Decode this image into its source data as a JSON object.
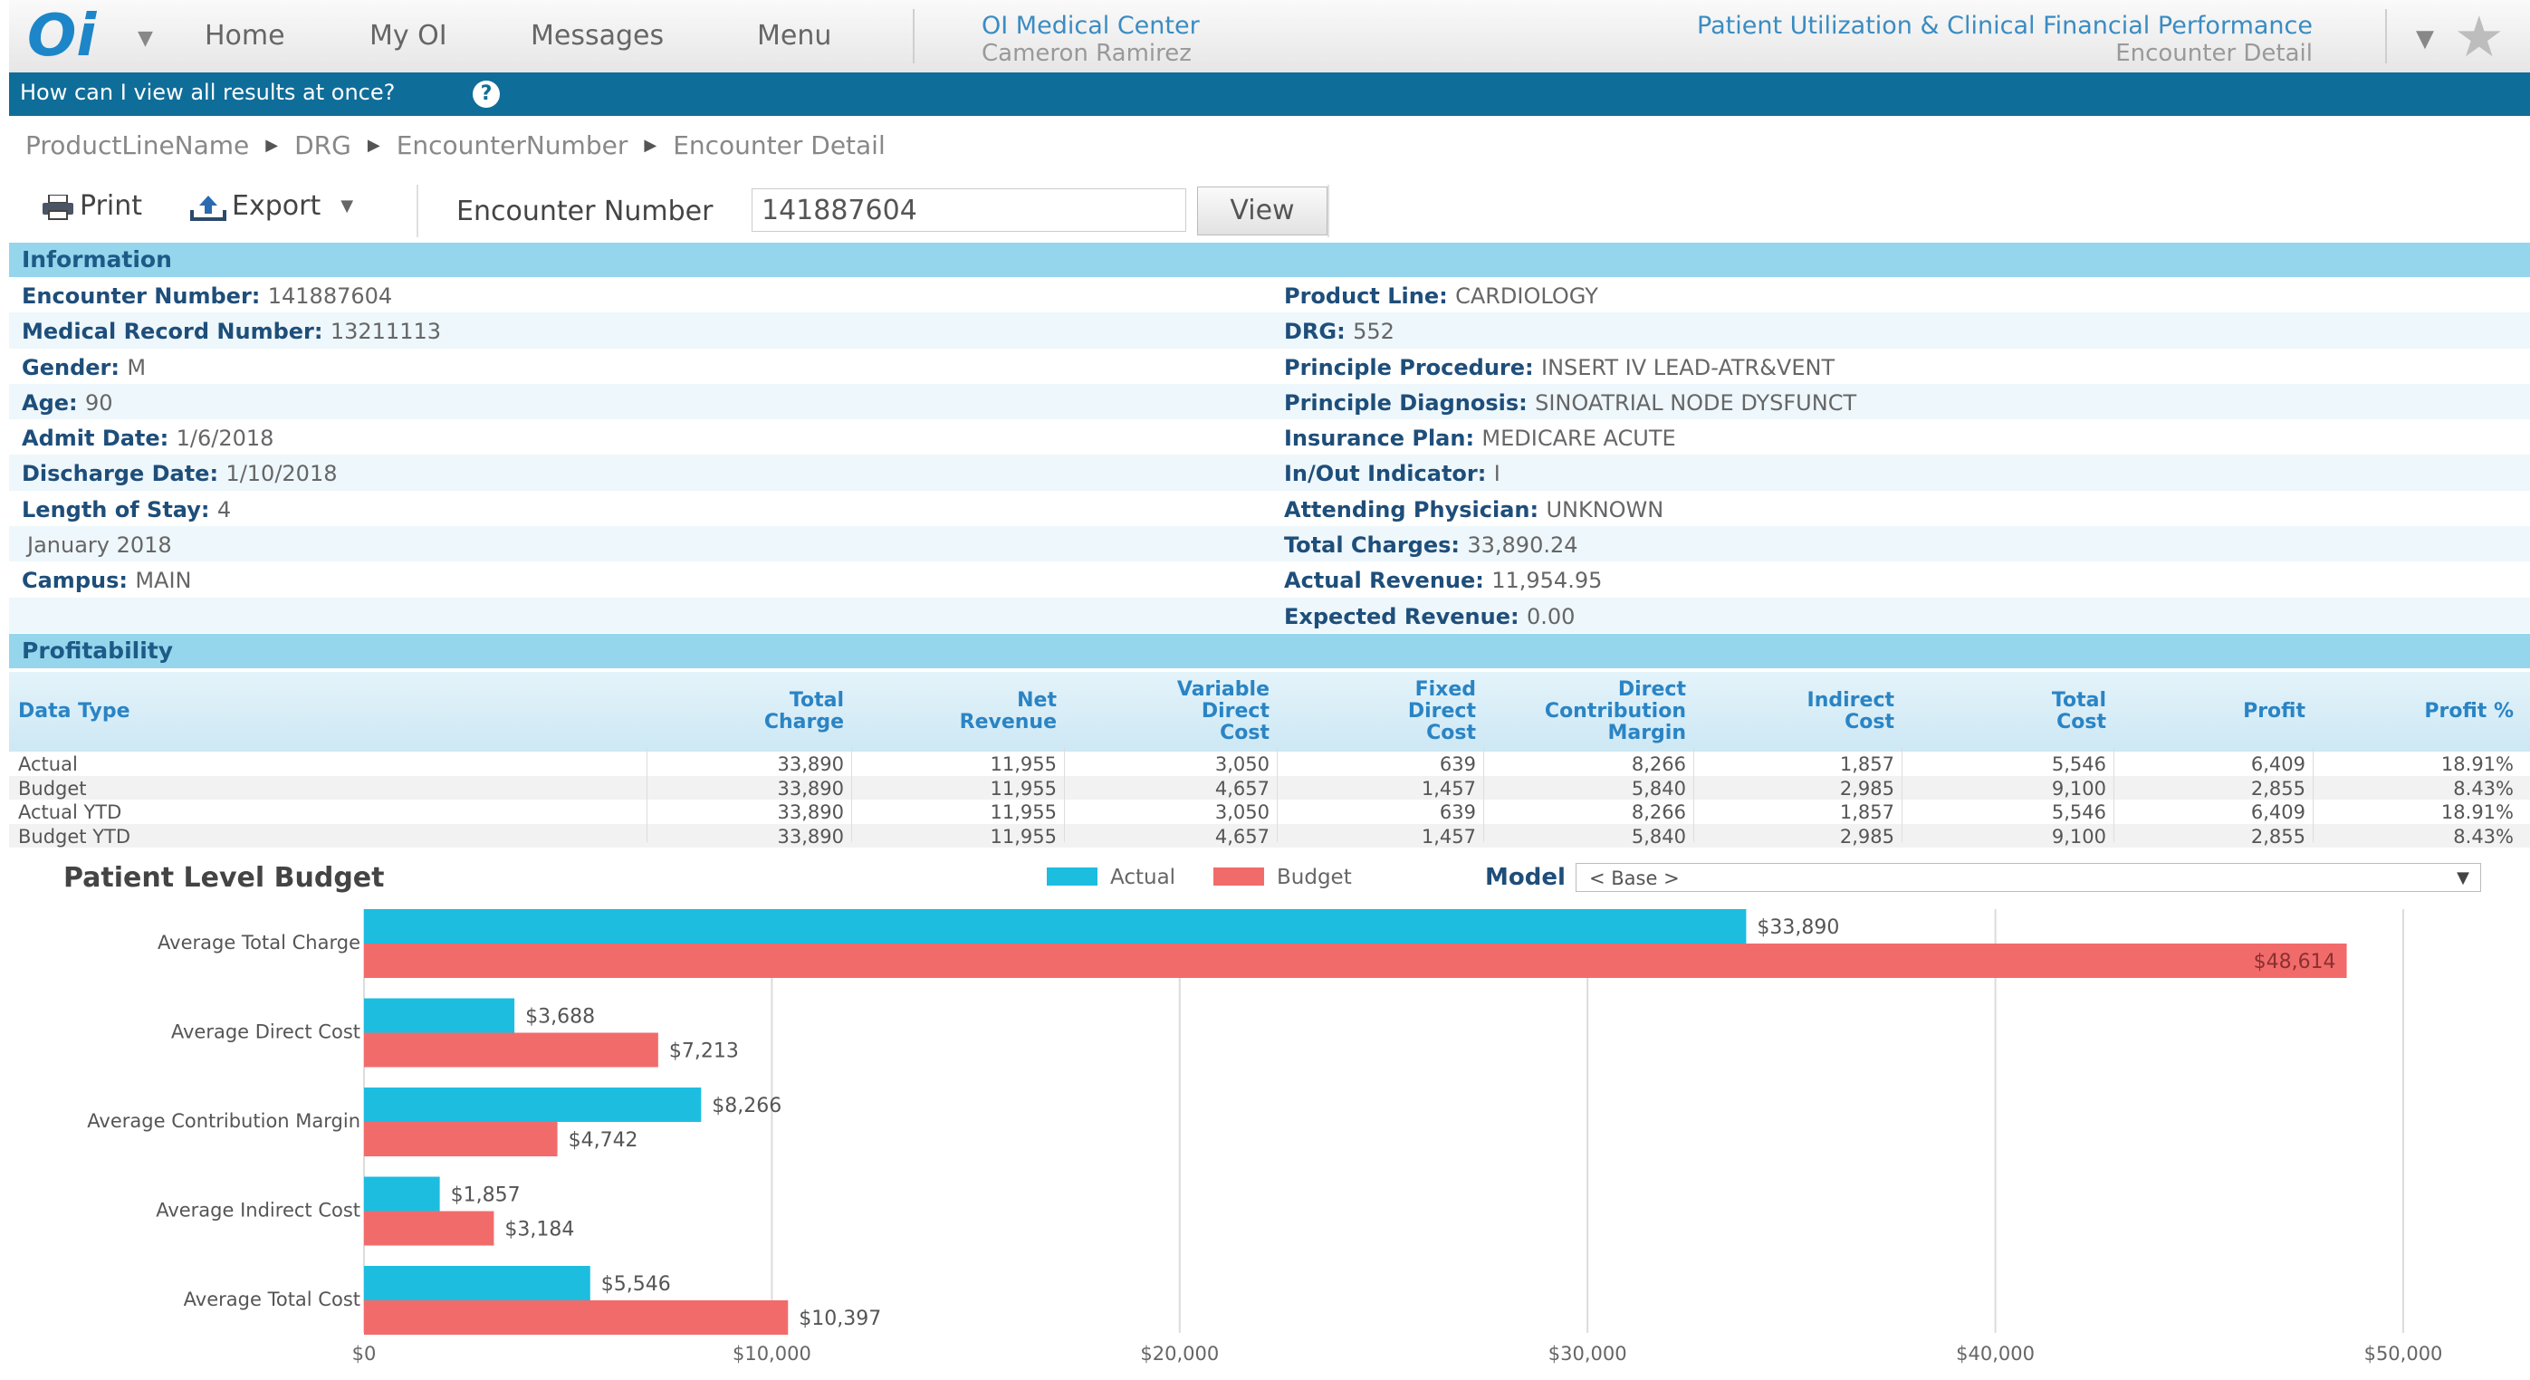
{
  "topbar": {
    "logo": "Oi",
    "nav": [
      "Home",
      "My OI",
      "Messages",
      "Menu"
    ],
    "org_name": "OI Medical Center",
    "user_name": "Cameron Ramirez",
    "report_title": "Patient Utilization & Clinical Financial Performance",
    "report_subtitle": "Encounter Detail"
  },
  "helpbar": {
    "question": "How can I view all results at once?",
    "icon": "?"
  },
  "breadcrumb": [
    "ProductLineName",
    "DRG",
    "EncounterNumber",
    "Encounter Detail"
  ],
  "toolbar": {
    "print_label": "Print",
    "export_label": "Export",
    "encounter_label": "Encounter Number",
    "encounter_value": "141887604",
    "view_label": "View"
  },
  "information": {
    "title": "Information",
    "left": [
      {
        "label": "Encounter Number:",
        "value": "141887604"
      },
      {
        "label": "Medical Record Number:",
        "value": "13211113"
      },
      {
        "label": "Gender:",
        "value": "M"
      },
      {
        "label": "Age:",
        "value": "90"
      },
      {
        "label": "Admit Date:",
        "value": "1/6/2018"
      },
      {
        "label": "Discharge Date:",
        "value": "1/10/2018"
      },
      {
        "label": "Length of Stay:",
        "value": "4"
      },
      {
        "label": "",
        "value": "January 2018"
      },
      {
        "label": "Campus:",
        "value": "MAIN"
      },
      {
        "label": "",
        "value": ""
      }
    ],
    "right": [
      {
        "label": "Product Line:",
        "value": "CARDIOLOGY"
      },
      {
        "label": "DRG:",
        "value": "552"
      },
      {
        "label": "Principle Procedure:",
        "value": "INSERT IV LEAD-ATR&VENT"
      },
      {
        "label": "Principle Diagnosis:",
        "value": "SINOATRIAL NODE DYSFUNCT"
      },
      {
        "label": "Insurance Plan:",
        "value": "MEDICARE ACUTE"
      },
      {
        "label": "In/Out Indicator:",
        "value": "I"
      },
      {
        "label": "Attending Physician:",
        "value": "UNKNOWN"
      },
      {
        "label": "Total Charges:",
        "value": "33,890.24"
      },
      {
        "label": "Actual Revenue:",
        "value": "11,954.95"
      },
      {
        "label": "Expected Revenue:",
        "value": "0.00"
      }
    ]
  },
  "profitability": {
    "title": "Profitability",
    "columns": [
      "Data Type",
      "Total\nCharge",
      "Net\nRevenue",
      "Variable\nDirect\nCost",
      "Fixed\nDirect\nCost",
      "Direct\nContribution\nMargin",
      "Indirect\nCost",
      "Total\nCost",
      "Profit",
      "Profit %"
    ],
    "rows": [
      [
        "Actual",
        "33,890",
        "11,955",
        "3,050",
        "639",
        "8,266",
        "1,857",
        "5,546",
        "6,409",
        "18.91%"
      ],
      [
        "Budget",
        "33,890",
        "11,955",
        "4,657",
        "1,457",
        "5,840",
        "2,985",
        "9,100",
        "2,855",
        "8.43%"
      ],
      [
        "Actual YTD",
        "33,890",
        "11,955",
        "3,050",
        "639",
        "8,266",
        "1,857",
        "5,546",
        "6,409",
        "18.91%"
      ],
      [
        "Budget YTD",
        "33,890",
        "11,955",
        "4,657",
        "1,457",
        "5,840",
        "2,985",
        "9,100",
        "2,855",
        "8.43%"
      ]
    ]
  },
  "chart_section": {
    "model_label": "Model",
    "model_value": "< Base >"
  },
  "chart_data": {
    "type": "bar",
    "orientation": "horizontal",
    "title": "Patient Level Budget",
    "categories": [
      "Average Total Charge",
      "Average Direct Cost",
      "Average Contribution Margin",
      "Average Indirect Cost",
      "Average Total Cost"
    ],
    "series": [
      {
        "name": "Actual",
        "color": "#1dbde0",
        "values": [
          33890,
          3688,
          8266,
          1857,
          5546
        ],
        "labels": [
          "$33,890",
          "$3,688",
          "$8,266",
          "$1,857",
          "$5,546"
        ]
      },
      {
        "name": "Budget",
        "color": "#f26b6b",
        "values": [
          48614,
          7213,
          4742,
          3184,
          10397
        ],
        "labels": [
          "$48,614",
          "$7,213",
          "$4,742",
          "$3,184",
          "$10,397"
        ]
      }
    ],
    "xlim": [
      0,
      50000
    ],
    "xticks": [
      0,
      10000,
      20000,
      30000,
      40000,
      50000
    ],
    "xtick_labels": [
      "$0",
      "$10,000",
      "$20,000",
      "$30,000",
      "$40,000",
      "$50,000"
    ],
    "grid": true,
    "legend": "top-center"
  }
}
